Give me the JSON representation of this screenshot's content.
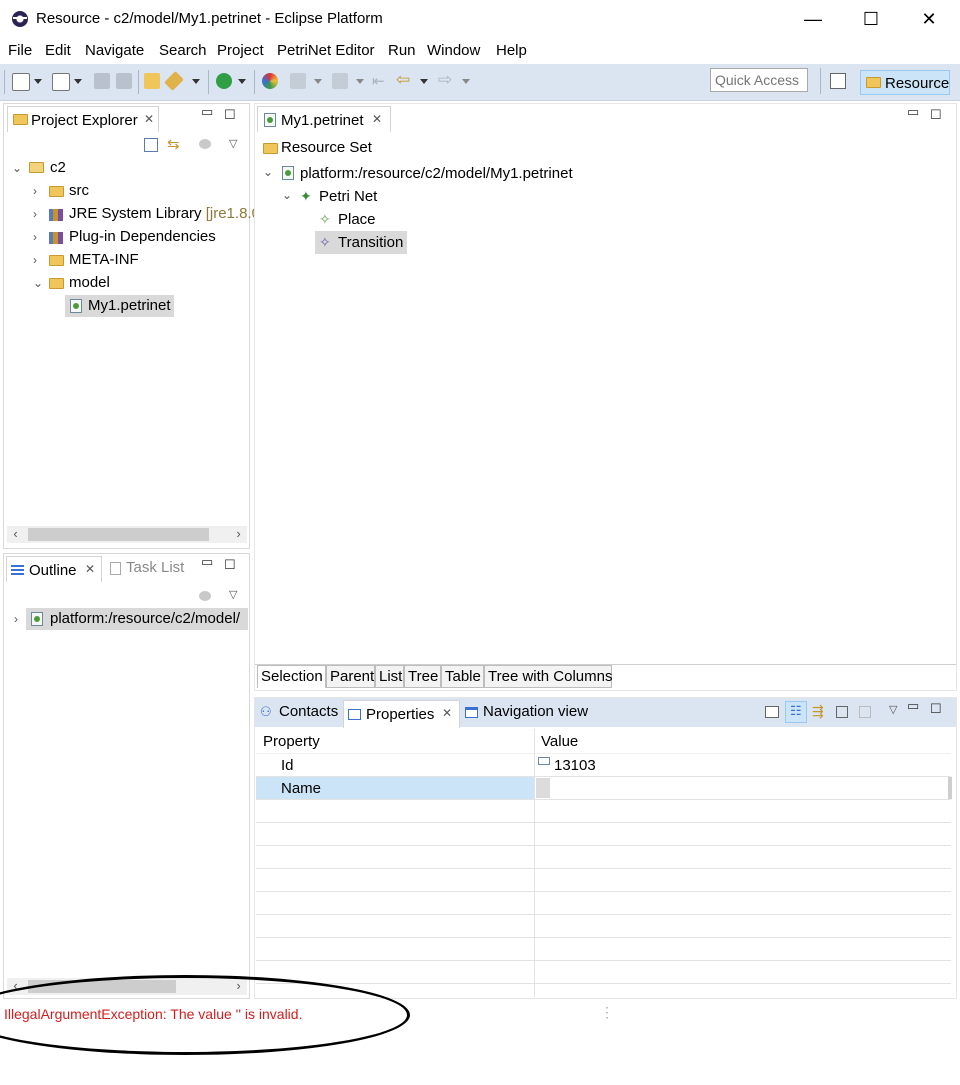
{
  "window": {
    "title": "Resource - c2/model/My1.petrinet - Eclipse Platform",
    "minimize": "—",
    "maximize": "☐",
    "close": "✕"
  },
  "menubar": [
    "File",
    "Edit",
    "Navigate",
    "Search",
    "Project",
    "PetriNet Editor",
    "Run",
    "Window",
    "Help"
  ],
  "toolbar": {
    "quick_access_placeholder": "Quick Access",
    "perspective": "Resource"
  },
  "project_explorer": {
    "title": "Project Explorer",
    "tree": [
      {
        "label": "c2",
        "icon": "project-icon",
        "expanded": true
      },
      {
        "label": "src",
        "icon": "source-folder-icon"
      },
      {
        "label": "JRE System Library",
        "suffix": "[jre1.8.0",
        "icon": "library-icon"
      },
      {
        "label": "Plug-in Dependencies",
        "icon": "library-icon"
      },
      {
        "label": "META-INF",
        "icon": "folder-icon"
      },
      {
        "label": "model",
        "icon": "folder-icon",
        "expanded": true
      },
      {
        "label": "My1.petrinet",
        "icon": "petrinet-file-icon",
        "selected": true
      }
    ]
  },
  "outline": {
    "title": "Outline",
    "task_list": "Task List",
    "item": "platform:/resource/c2/model/"
  },
  "editor": {
    "tab": "My1.petrinet",
    "root": "Resource Set",
    "resource": "platform:/resource/c2/model/My1.petrinet",
    "petri_net": "Petri Net",
    "place": "Place",
    "transition": "Transition",
    "subtabs": [
      "Selection",
      "Parent",
      "List",
      "Tree",
      "Table",
      "Tree with Columns"
    ]
  },
  "bottom_panel": {
    "tabs": [
      "Contacts",
      "Properties",
      "Navigation view"
    ],
    "columns": [
      "Property",
      "Value"
    ],
    "rows": [
      {
        "property": "Id",
        "value": "13103"
      },
      {
        "property": "Name",
        "value": ""
      }
    ]
  },
  "status": {
    "message": "IllegalArgumentException: The value '' is invalid."
  }
}
